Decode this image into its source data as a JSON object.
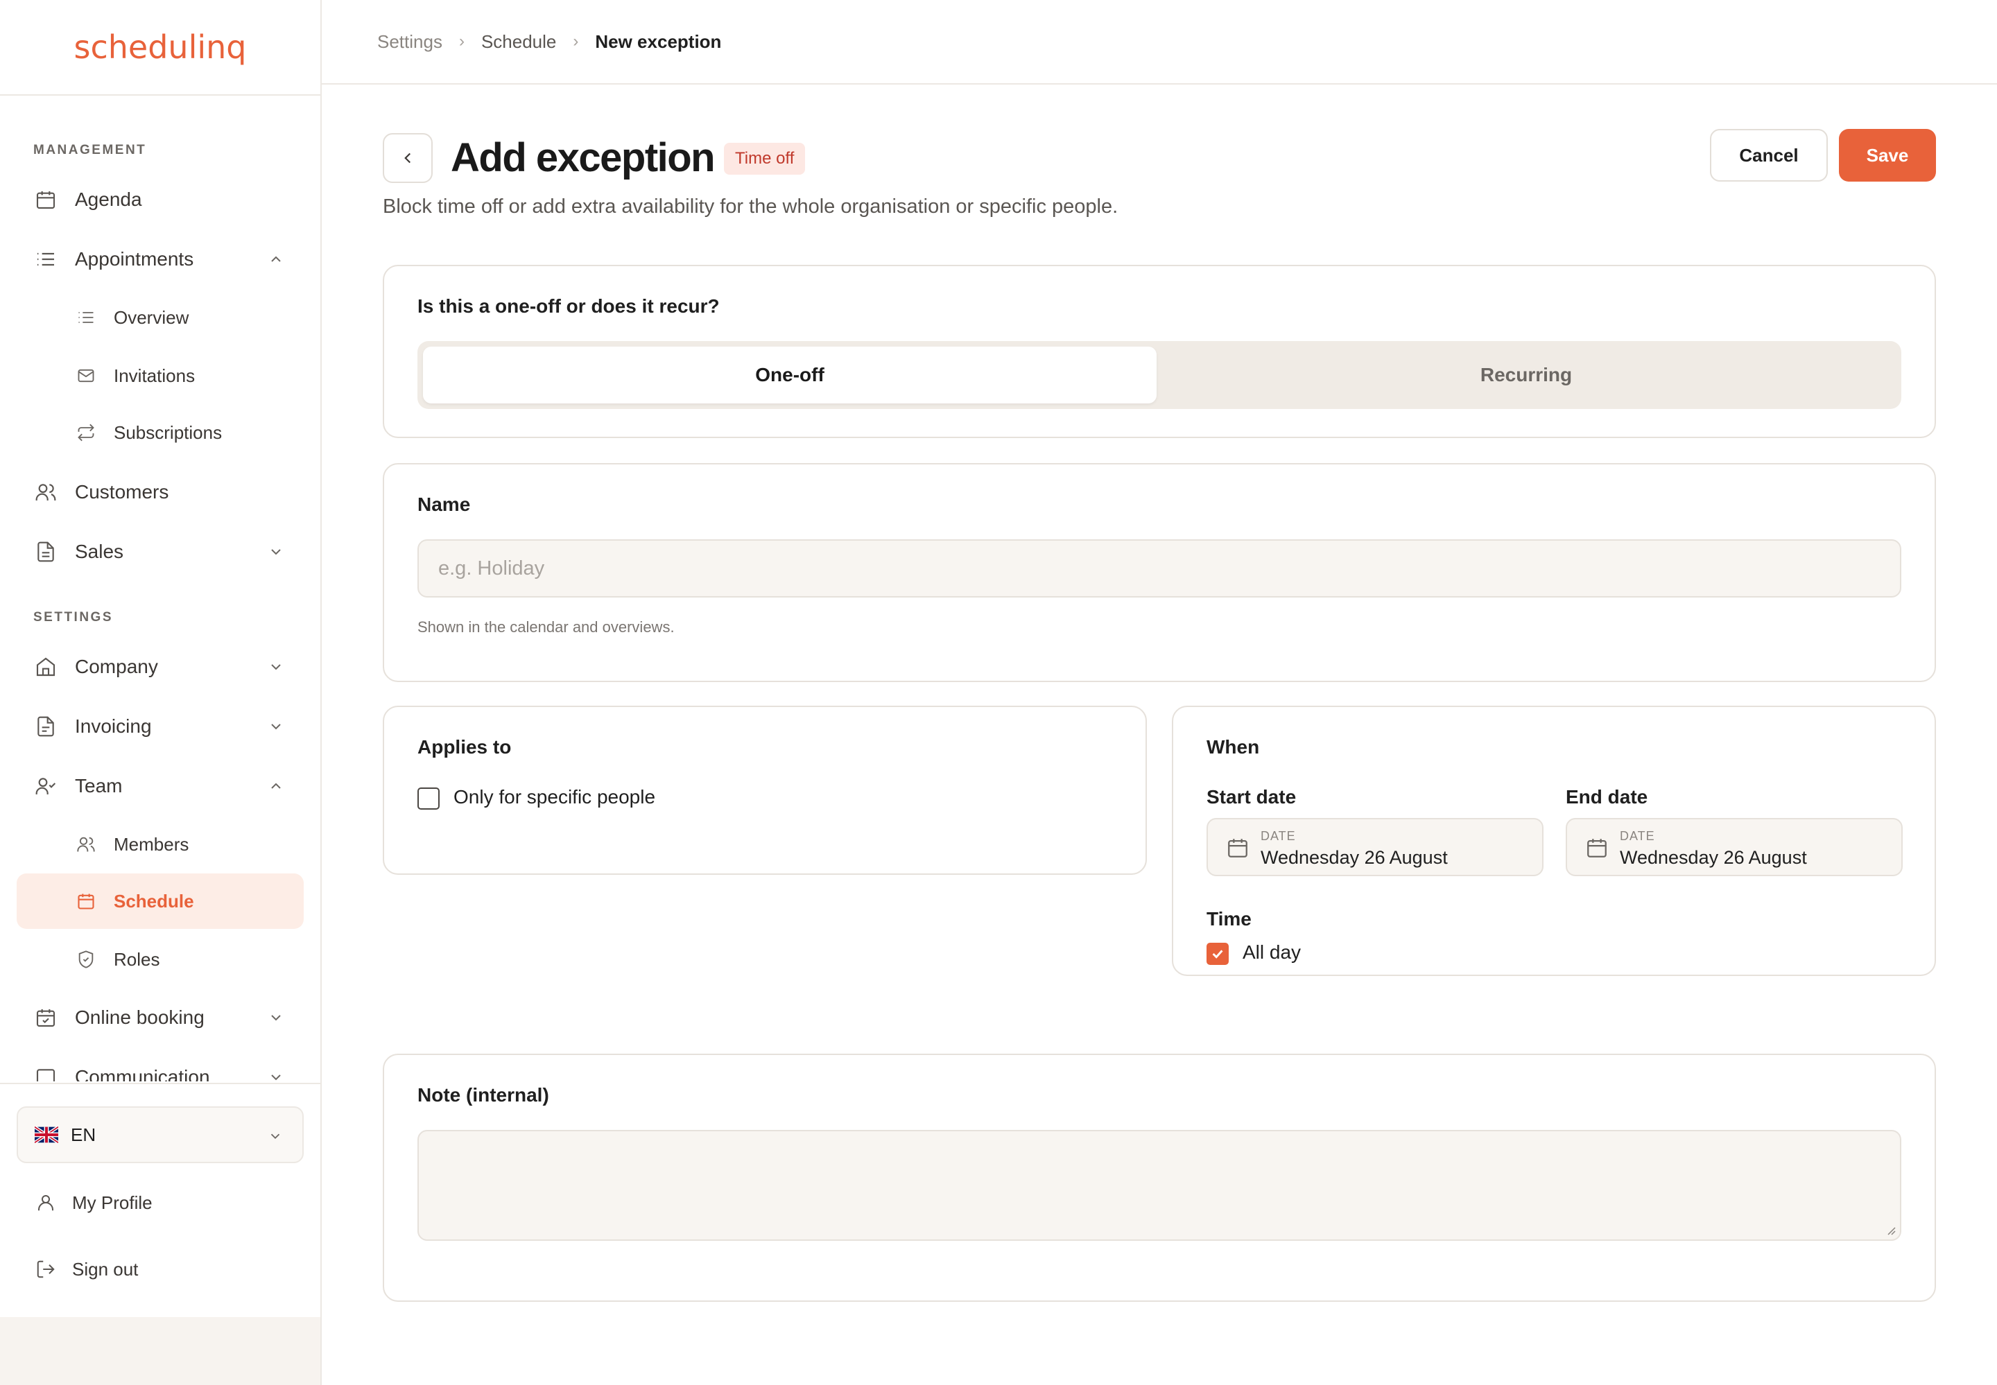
{
  "brand": {
    "logo": "schedulinq",
    "accent": "#e8623a"
  },
  "sidebar": {
    "management_label": "MANAGEMENT",
    "settings_label": "SETTINGS",
    "items": {
      "agenda": "Agenda",
      "appointments": "Appointments",
      "overview": "Overview",
      "invitations": "Invitations",
      "subscriptions": "Subscriptions",
      "customers": "Customers",
      "sales": "Sales",
      "company": "Company",
      "invoicing": "Invoicing",
      "team": "Team",
      "members": "Members",
      "schedule": "Schedule",
      "roles": "Roles",
      "online_booking": "Online booking",
      "communication": "Communication"
    },
    "language": "EN",
    "my_profile": "My Profile",
    "sign_out": "Sign out"
  },
  "breadcrumb": [
    "Settings",
    "Schedule",
    "New exception"
  ],
  "header": {
    "title": "Add exception",
    "badge": "Time off",
    "subtitle": "Block time off or add extra availability for the whole organisation or specific people.",
    "cancel": "Cancel",
    "save": "Save"
  },
  "recurrence": {
    "question": "Is this a one-off or does it recur?",
    "options": [
      "One-off",
      "Recurring"
    ],
    "selected": "One-off"
  },
  "name_field": {
    "label": "Name",
    "placeholder": "e.g. Holiday",
    "value": "",
    "helper": "Shown in the calendar and overviews."
  },
  "applies_to": {
    "title": "Applies to",
    "specific_people_label": "Only for specific people",
    "specific_people_checked": false
  },
  "when": {
    "title": "When",
    "start_label": "Start date",
    "end_label": "End date",
    "date_caption": "DATE",
    "start_value": "Wednesday 26 August",
    "end_value": "Wednesday 26 August",
    "time_label": "Time",
    "all_day_label": "All day",
    "all_day_checked": true
  },
  "note": {
    "label": "Note (internal)",
    "value": ""
  }
}
